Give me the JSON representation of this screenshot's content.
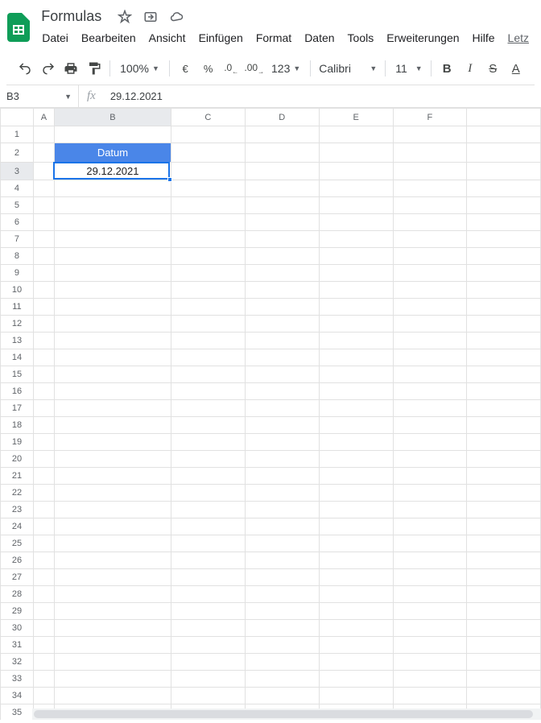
{
  "doc": {
    "title": "Formulas"
  },
  "menu": {
    "file": "Datei",
    "edit": "Bearbeiten",
    "view": "Ansicht",
    "insert": "Einfügen",
    "format": "Format",
    "data": "Daten",
    "tools": "Tools",
    "extensions": "Erweiterungen",
    "help": "Hilfe",
    "last": "Letz"
  },
  "toolbar": {
    "zoom": "100%",
    "currency": "€",
    "percent": "%",
    "dec_dec": ".0",
    "dec_inc": ".00",
    "more_fmt": "123",
    "font": "Calibri",
    "size": "11"
  },
  "formula_bar": {
    "cell_ref": "B3",
    "fx": "fx",
    "value": "29.12.2021"
  },
  "columns": [
    "A",
    "B",
    "C",
    "D",
    "E",
    "F",
    ""
  ],
  "rows": 35,
  "cells": {
    "b2": "Datum",
    "b3": "29.12.2021"
  },
  "selection": {
    "row": 3,
    "col": "B"
  }
}
